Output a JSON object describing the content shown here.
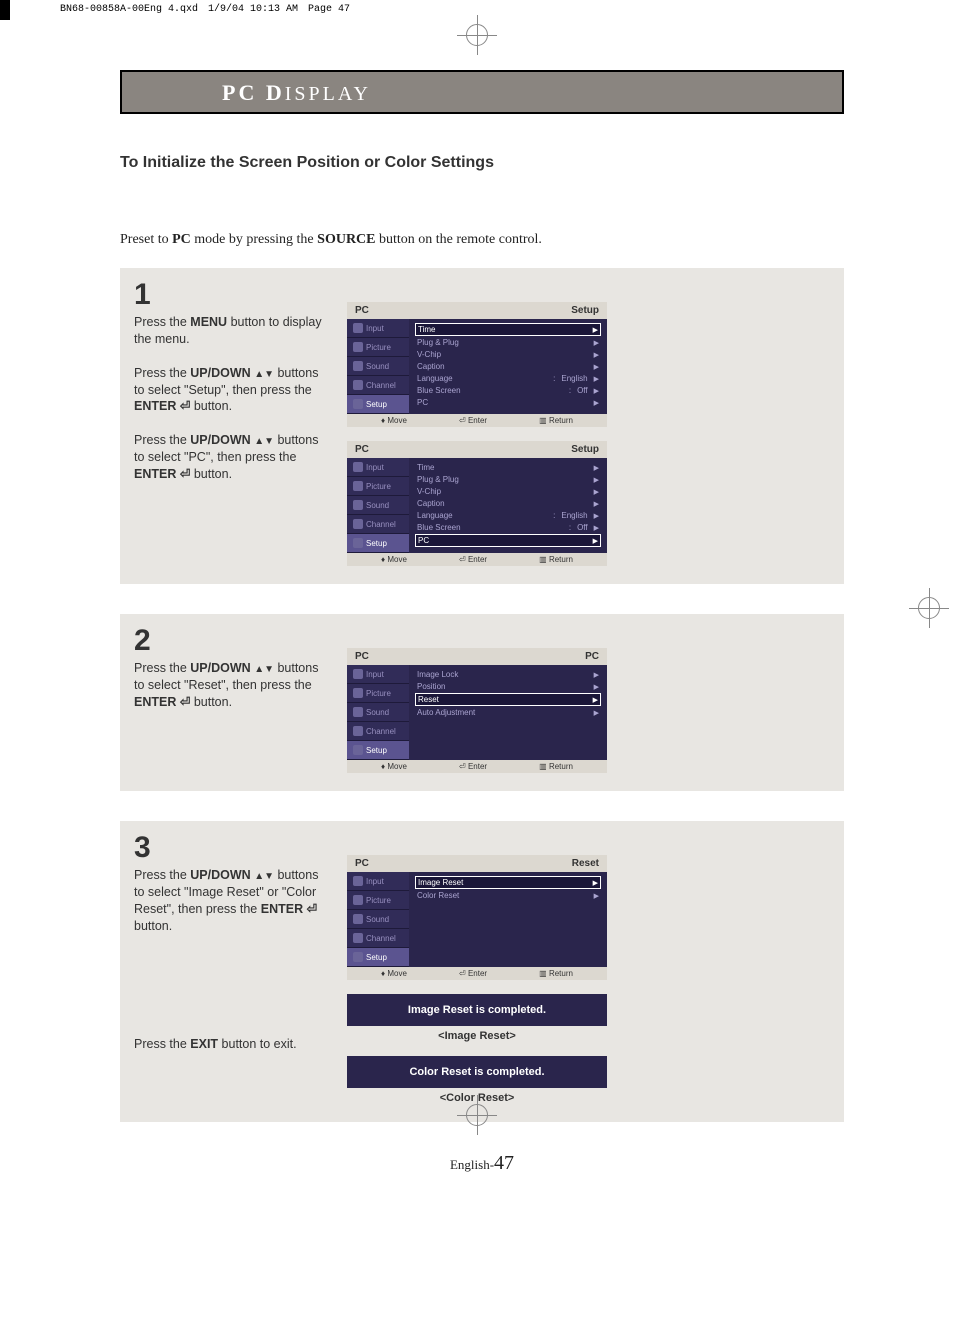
{
  "print_header": {
    "file": "BN68-00858A-00Eng 4.qxd",
    "date": "1/9/04 10:13 AM",
    "page": "Page 47"
  },
  "section_title_prefix": "PC D",
  "section_title_rest": "ISPLAY",
  "subtitle": "To Initialize the Screen Position or Color Settings",
  "preset_pre": "Preset to ",
  "preset_pc": "PC",
  "preset_mid": " mode by pressing the ",
  "preset_source": "SOURCE",
  "preset_post": " button on the remote control.",
  "step1": {
    "num": "1",
    "p1_a": "Press the ",
    "p1_b": "MENU",
    "p1_c": " button to display the menu.",
    "p2_a": "Press the ",
    "p2_b": "UP/DOWN",
    "p2_c": " buttons to select \"Setup\", then press the ",
    "p2_d": "ENTER",
    "p2_e": "  button.",
    "p3_a": "Press the ",
    "p3_b": "UP/DOWN",
    "p3_c": " buttons to select \"PC\", then press the ",
    "p3_d": "ENTER",
    "p3_e": " button."
  },
  "step2": {
    "num": "2",
    "a": "Press the ",
    "b": "UP/DOWN",
    "c": " buttons to select \"Reset\", then press the ",
    "d": "ENTER",
    "e": " button."
  },
  "step3": {
    "num": "3",
    "a": "Press the ",
    "b": "UP/DOWN",
    "c": " buttons to select \"Image Reset\" or \"Color Reset\", then press the ",
    "d": "ENTER",
    "e": " button.",
    "exit_a": "Press the ",
    "exit_b": "EXIT",
    "exit_c": " button to exit."
  },
  "osd_labels": {
    "pc": "PC",
    "setup": "Setup",
    "pc_title": "PC",
    "reset_title": "Reset",
    "tabs": {
      "input": "Input",
      "picture": "Picture",
      "sound": "Sound",
      "channel": "Channel",
      "setup": "Setup"
    },
    "setup_items": {
      "time": "Time",
      "plug": "Plug & Plug",
      "vchip": "V-Chip",
      "caption": "Caption",
      "language": "Language",
      "blue": "Blue Screen",
      "pc": "PC",
      "english": "English",
      "off": "Off"
    },
    "pc_items": {
      "imagelock": "Image Lock",
      "position": "Position",
      "reset": "Reset",
      "auto": "Auto Adjustment"
    },
    "reset_items": {
      "image": "Image Reset",
      "color": "Color Reset"
    },
    "footer": {
      "move": "Move",
      "enter": "Enter",
      "return": "Return"
    }
  },
  "toasts": {
    "image": "Image Reset is completed.",
    "image_cap": "<Image Reset>",
    "color": "Color Reset is completed.",
    "color_cap": "<Color Reset>"
  },
  "page_num_prefix": "English-",
  "page_num": "47",
  "enter_sym": "⏎",
  "updown_sym": "▲▼",
  "arrow": "▶",
  "footer_move_sym": "♦",
  "footer_enter_sym": "⏎",
  "footer_return_sym": "▥"
}
